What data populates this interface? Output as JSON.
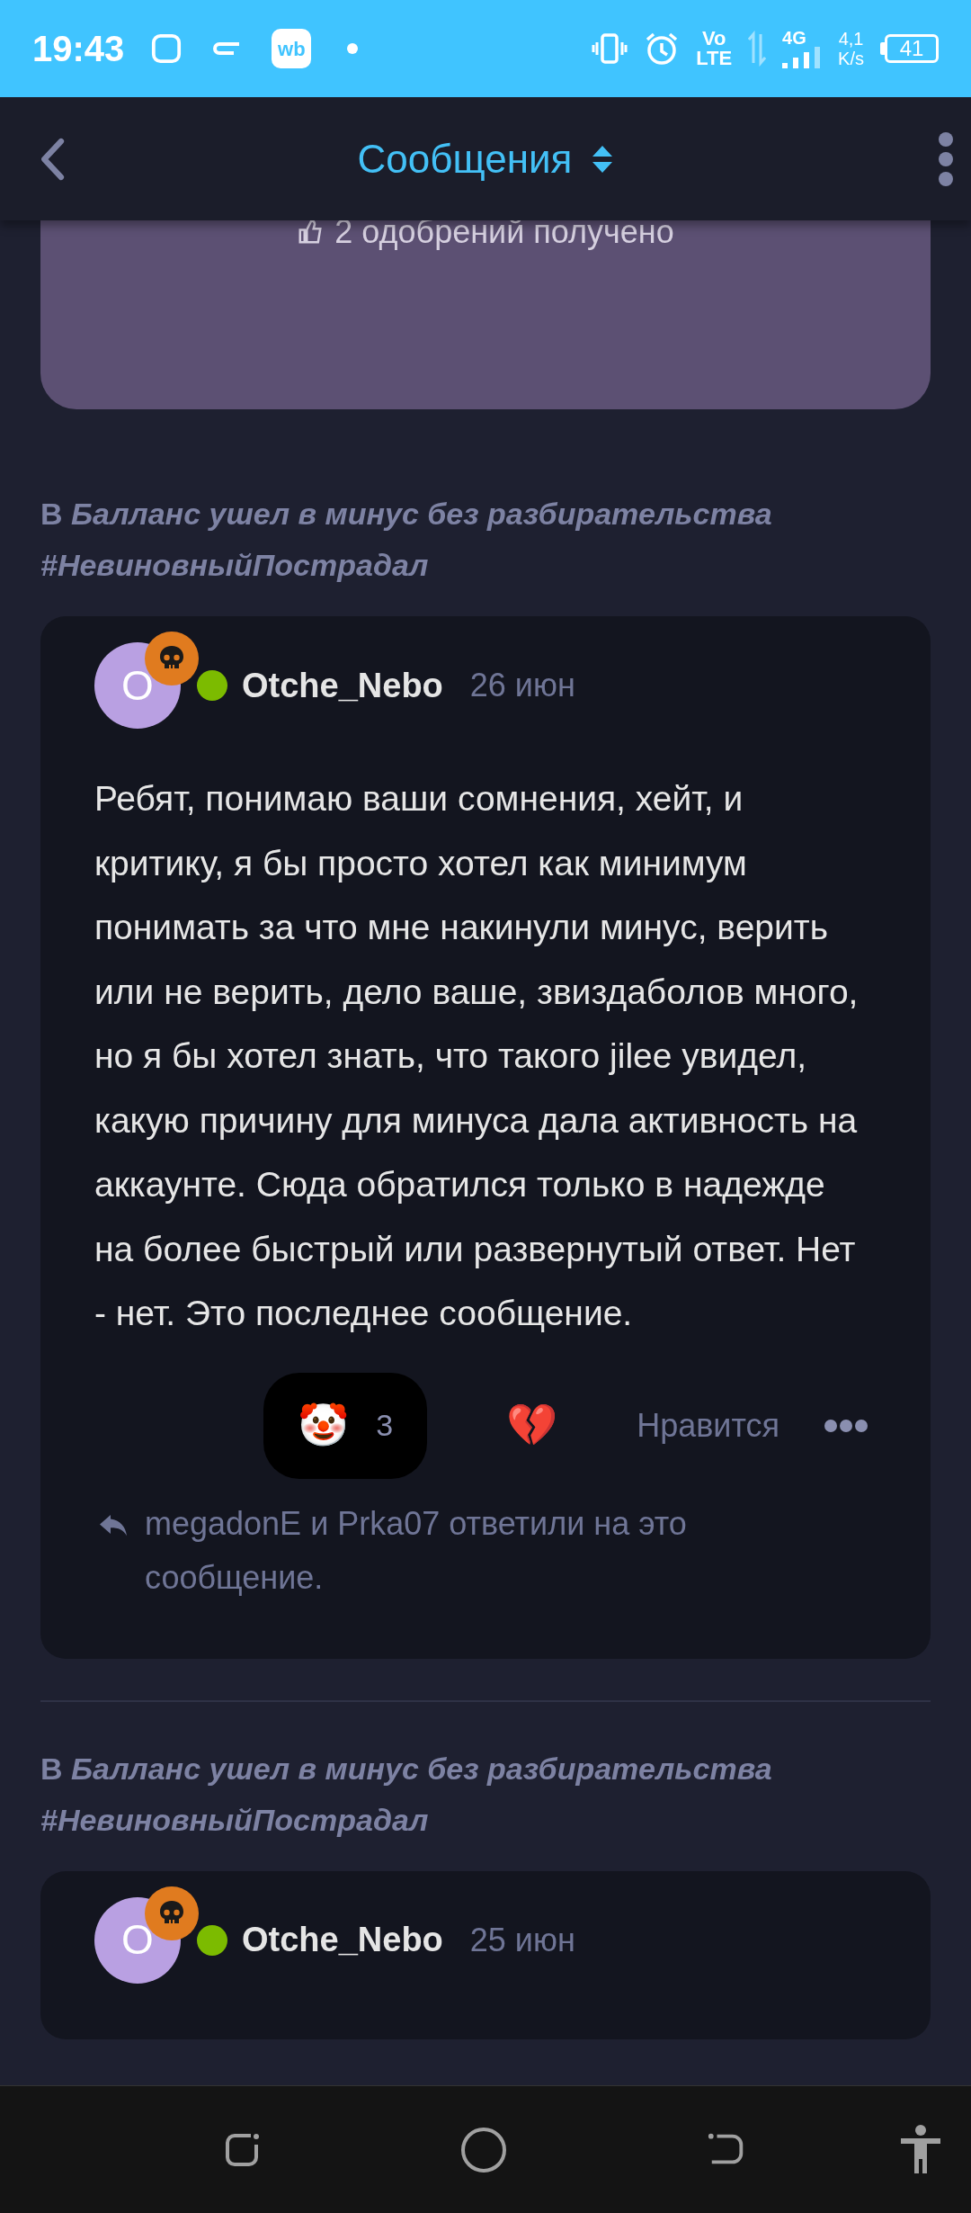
{
  "status_bar": {
    "time": "19:43",
    "app_badge": "wb",
    "volte_top": "Vo",
    "volte_bottom": "LTE",
    "network": "4G",
    "speed_value": "4,1",
    "speed_unit": "K/s",
    "battery": "41"
  },
  "header": {
    "title": "Сообщения"
  },
  "top_card": {
    "text": "2 одобрений получено"
  },
  "posts": [
    {
      "thread_prefix": "В",
      "thread_title": "Балланс ушел в минус без разбирательства #НевиновныйПострадал",
      "avatar_letter": "O",
      "author": "Otche_Nebo",
      "online": true,
      "date": "26 июн",
      "body": "Ребят, понимаю ваши сомнения, хейт, и критику, я бы просто хотел как минимум понимать за что мне накинули минус, верить или не верить, дело ваше, звиздаболов много, но я бы хотел знать, что такого jilee увидел, какую причину для минуса дала активность на аккаунте. Сюда обратился только в надежде на более быстрый или развернутый ответ. Нет - нет. Это последнее сообщение.",
      "reactions": [
        {
          "emoji": "🤡",
          "count": "3",
          "selected": true
        },
        {
          "emoji": "💔",
          "selected": false
        }
      ],
      "like": "Нравится",
      "replies": "megadonE и Prka07 ответили на это сообщение."
    },
    {
      "thread_prefix": "В",
      "thread_title": "Балланс ушел в минус без разбирательства #НевиновныйПострадал",
      "avatar_letter": "O",
      "author": "Otche_Nebo",
      "online": true,
      "date": "25 июн"
    }
  ]
}
